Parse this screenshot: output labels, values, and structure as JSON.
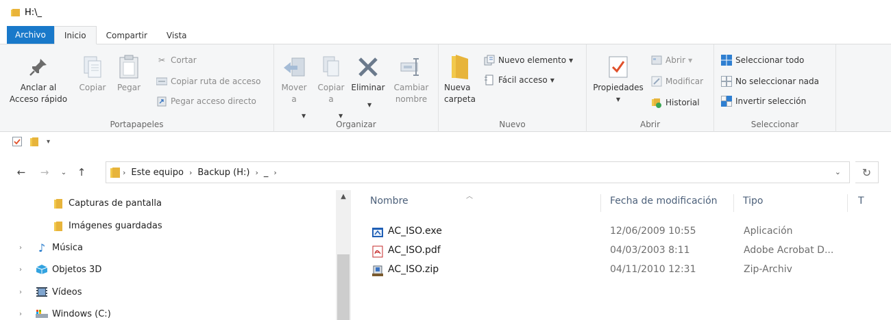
{
  "window": {
    "title": "H:\\_"
  },
  "tabs": [
    {
      "label": "Archivo"
    },
    {
      "label": "Inicio"
    },
    {
      "label": "Compartir"
    },
    {
      "label": "Vista"
    }
  ],
  "ribbon": {
    "portapapeles": {
      "label": "Portapapeles",
      "pin": "Anclar al\nAcceso rápido",
      "copy": "Copiar",
      "paste": "Pegar",
      "cut": "Cortar",
      "copy_path": "Copiar ruta de acceso",
      "paste_shortcut": "Pegar acceso directo"
    },
    "organizar": {
      "label": "Organizar",
      "move": "Mover\na",
      "copy_to": "Copiar\na",
      "delete": "Eliminar",
      "rename": "Cambiar\nnombre"
    },
    "nuevo": {
      "label": "Nuevo",
      "new_folder": "Nueva\ncarpeta",
      "new_item": "Nuevo elemento",
      "easy_access": "Fácil acceso"
    },
    "abrir": {
      "label": "Abrir",
      "properties": "Propiedades",
      "open": "Abrir",
      "edit": "Modificar",
      "history": "Historial"
    },
    "seleccionar": {
      "label": "Seleccionar",
      "select_all": "Seleccionar todo",
      "select_none": "No seleccionar nada",
      "invert": "Invertir selección"
    }
  },
  "address": {
    "crumbs": [
      "Este equipo",
      "Backup (H:)",
      "_"
    ]
  },
  "nav_pane": {
    "items": [
      {
        "label": "Capturas de pantalla",
        "icon": "folder-icon"
      },
      {
        "label": "Imágenes guardadas",
        "icon": "folder-icon"
      },
      {
        "label": "Música",
        "icon": "music-note-icon"
      },
      {
        "label": "Objetos 3D",
        "icon": "3d-objects-icon"
      },
      {
        "label": "Vídeos",
        "icon": "video-icon"
      },
      {
        "label": "Windows (C:)",
        "icon": "drive-icon"
      }
    ]
  },
  "columns": {
    "name": "Nombre",
    "date": "Fecha de modificación",
    "type": "Tipo",
    "size": "T"
  },
  "files": [
    {
      "name": "AC_ISO.exe",
      "date": "12/06/2009 10:55",
      "type": "Aplicación",
      "icon": "exe-icon"
    },
    {
      "name": "AC_ISO.pdf",
      "date": "04/03/2003 8:11",
      "type": "Adobe Acrobat D...",
      "icon": "pdf-icon"
    },
    {
      "name": "AC_ISO.zip",
      "date": "04/11/2010 12:31",
      "type": "Zip-Archiv",
      "icon": "zip-icon"
    }
  ],
  "colors": {
    "file_tab": "#1979ca",
    "ribbon_bg": "#f5f6f7",
    "folder": "#f2c94c"
  }
}
